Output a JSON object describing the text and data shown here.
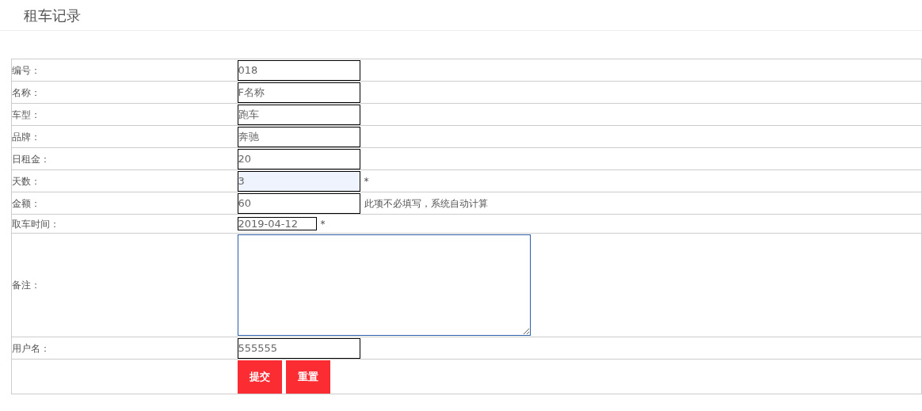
{
  "title": "租车记录",
  "fields": [
    {
      "kind": "text",
      "label": "编号：",
      "value": "018",
      "highlighted": false
    },
    {
      "kind": "text",
      "label": "名称：",
      "value": "F名称",
      "highlighted": false
    },
    {
      "kind": "text",
      "label": "车型：",
      "value": "跑车",
      "highlighted": false
    },
    {
      "kind": "text",
      "label": "品牌：",
      "value": "奔驰",
      "highlighted": false
    },
    {
      "kind": "text",
      "label": "日租金：",
      "value": "20",
      "highlighted": false
    },
    {
      "kind": "text",
      "label": "天数：",
      "value": "3",
      "highlighted": true,
      "note": "*"
    },
    {
      "kind": "text",
      "label": "金额：",
      "value": "60",
      "highlighted": false,
      "note": "此项不必填写，系统自动计算"
    },
    {
      "kind": "date",
      "label": "取车时间：",
      "value": "2019-04-12",
      "highlighted": false,
      "note": "*"
    },
    {
      "kind": "textarea",
      "label": "备注：",
      "highlighted": true
    },
    {
      "kind": "text",
      "label": "用户名：",
      "value": "555555",
      "highlighted": false
    }
  ],
  "buttons": [
    "提交",
    "重置"
  ]
}
